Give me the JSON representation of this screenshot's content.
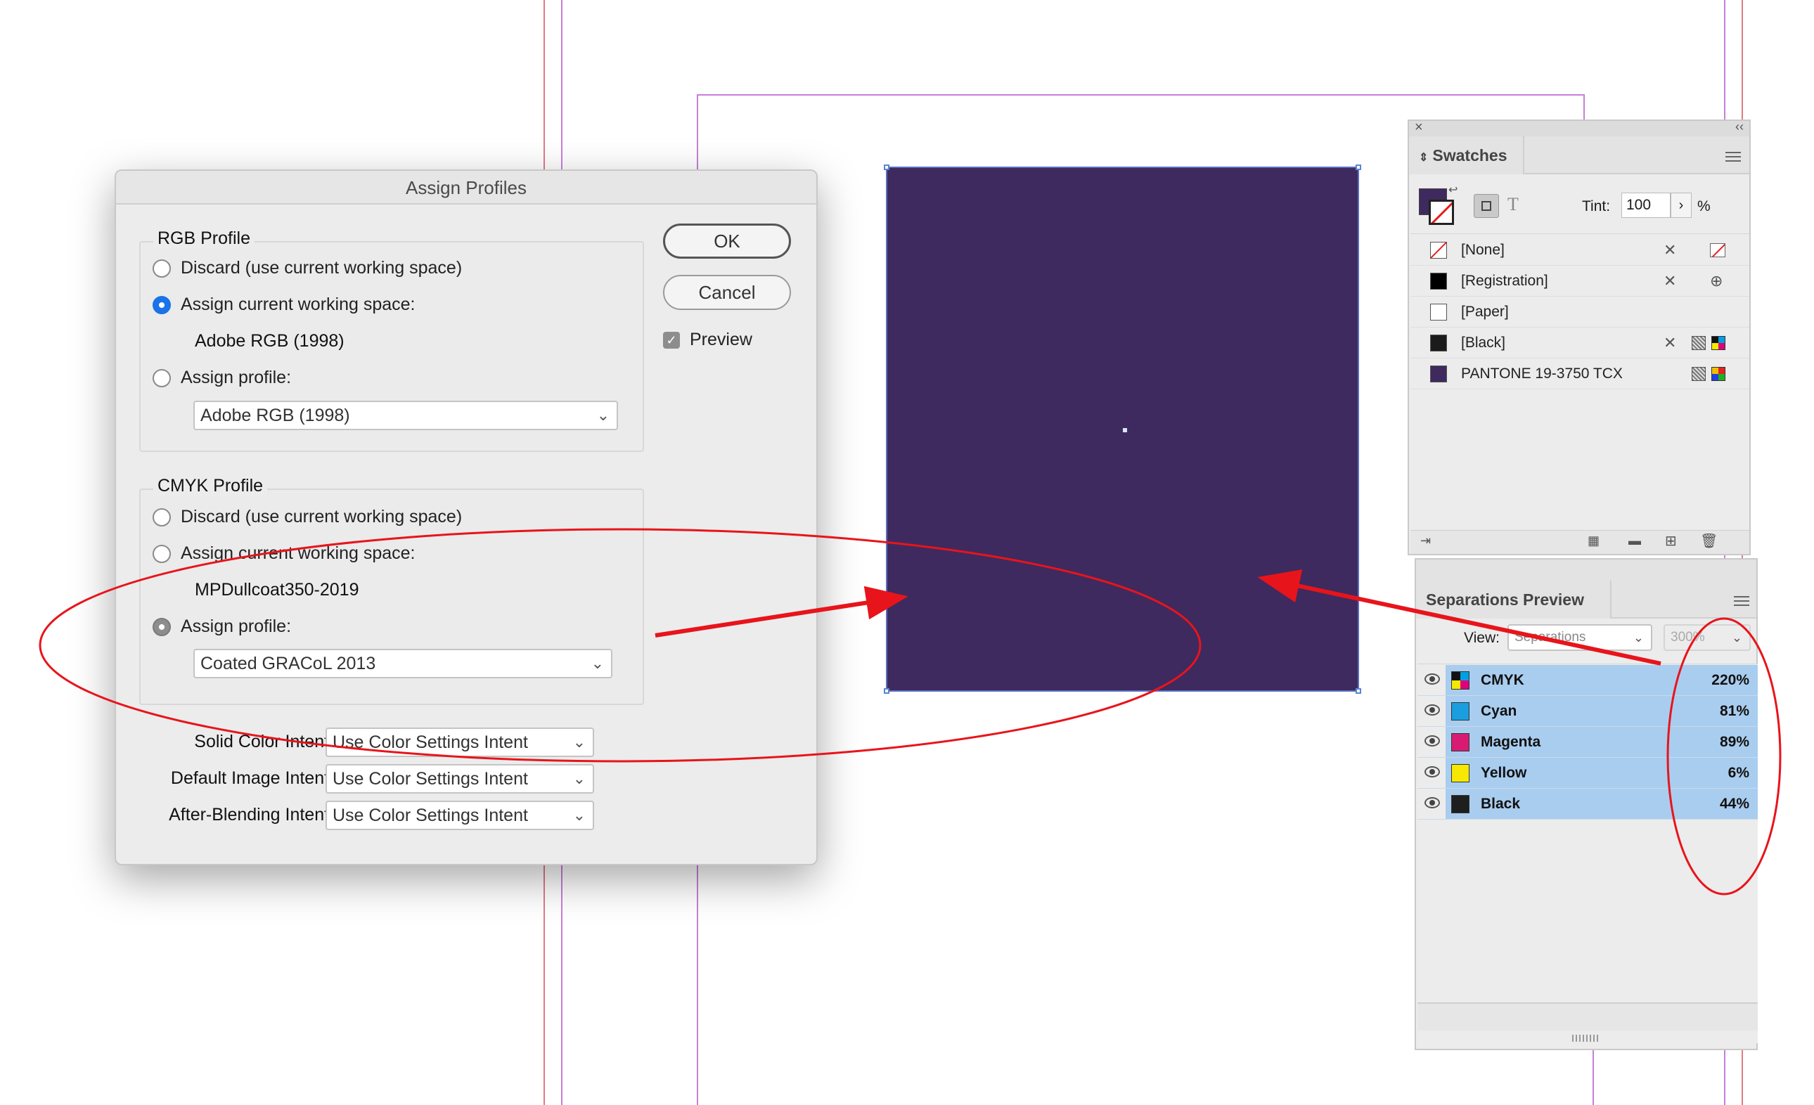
{
  "dialog": {
    "title": "Assign Profiles",
    "rgb_group": {
      "title": "RGB Profile",
      "discard_label": "Discard (use current working space)",
      "assign_current_label": "Assign current working space:",
      "current_space": "Adobe RGB (1998)",
      "assign_profile_label": "Assign profile:",
      "profile_select": "Adobe RGB (1998)"
    },
    "cmyk_group": {
      "title": "CMYK Profile",
      "discard_label": "Discard (use current working space)",
      "assign_current_label": "Assign current working space:",
      "current_space": "MPDullcoat350-2019",
      "assign_profile_label": "Assign profile:",
      "profile_select": "Coated GRACoL 2013"
    },
    "intents": [
      {
        "label": "Solid Color Intent:",
        "value": "Use Color Settings Intent"
      },
      {
        "label": "Default Image Intent:",
        "value": "Use Color Settings Intent"
      },
      {
        "label": "After-Blending Intent:",
        "value": "Use Color Settings Intent"
      }
    ],
    "ok_label": "OK",
    "cancel_label": "Cancel",
    "preview_label": "Preview",
    "preview_checked": true
  },
  "swatches_panel": {
    "tab_label": "Swatches",
    "tint_label": "Tint:",
    "tint_value": "100",
    "percent": "%",
    "fill_color": "#3e2a5e",
    "items": [
      {
        "name": "[None]",
        "color": "none"
      },
      {
        "name": "[Registration]",
        "color": "#000000"
      },
      {
        "name": "[Paper]",
        "color": "#ffffff"
      },
      {
        "name": "[Black]",
        "color": "#1b1b1b"
      },
      {
        "name": "PANTONE 19-3750 TCX",
        "color": "#3e2a5e"
      }
    ]
  },
  "separations_panel": {
    "tab_label": "Separations Preview",
    "view_label": "View:",
    "view_value": "Separations",
    "zoom_value": "300%",
    "rows": [
      {
        "name": "CMYK",
        "percent": "220%",
        "color": "cmyk"
      },
      {
        "name": "Cyan",
        "percent": "81%",
        "color": "#1a9ee0"
      },
      {
        "name": "Magenta",
        "percent": "89%",
        "color": "#d81b72"
      },
      {
        "name": "Yellow",
        "percent": "6%",
        "color": "#f6e800"
      },
      {
        "name": "Black",
        "percent": "44%",
        "color": "#1e1e1e"
      }
    ]
  },
  "canvas": {
    "object_color": "#3e2a5e",
    "annotation_color": "#e8141b"
  }
}
